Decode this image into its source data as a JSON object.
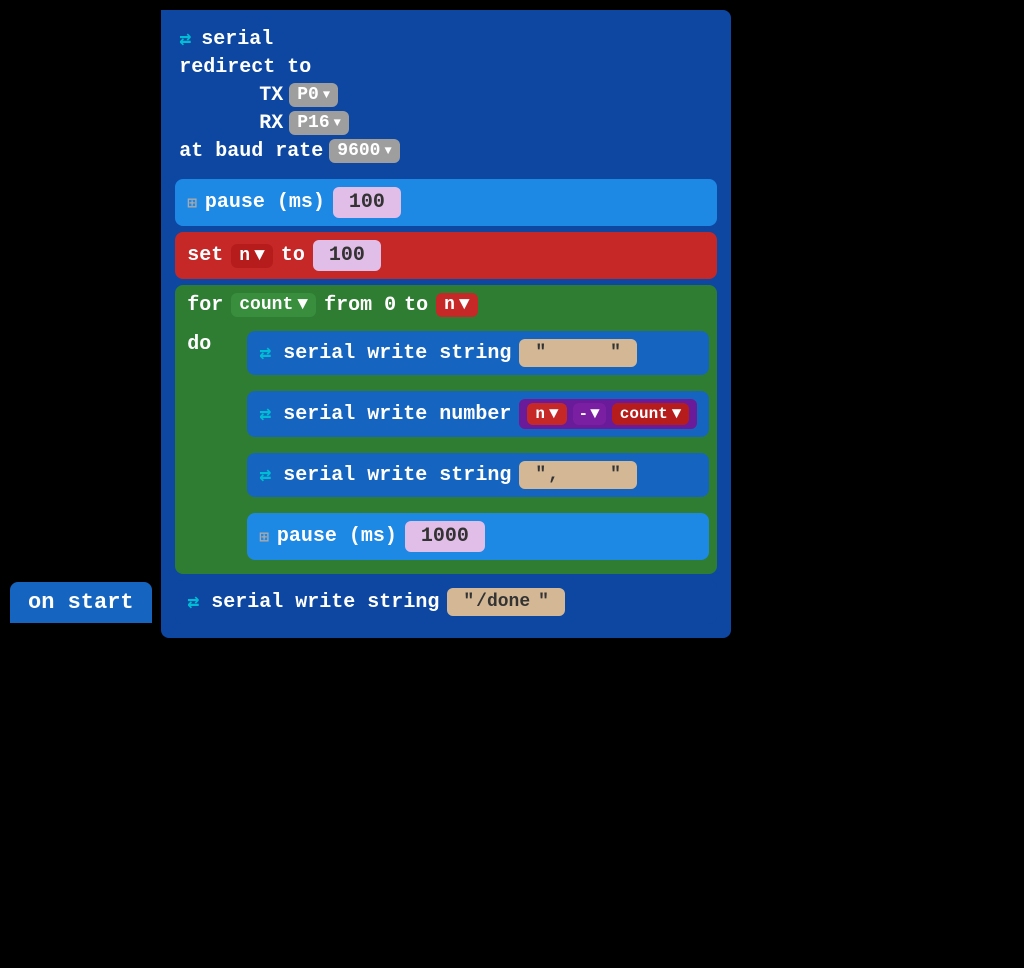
{
  "header": {
    "title": "on start"
  },
  "serial_redirect": {
    "line1": "serial",
    "line2": "redirect to",
    "tx_label": "TX",
    "tx_value": "P0",
    "rx_label": "RX",
    "rx_value": "P16",
    "baud_label": "at baud rate",
    "baud_value": "9600"
  },
  "pause1": {
    "label": "pause (ms)",
    "value": "100"
  },
  "set_block": {
    "label": "set",
    "var": "n",
    "to": "to",
    "value": "100"
  },
  "for_block": {
    "label": "for",
    "var": "count",
    "from": "from 0",
    "to": "to",
    "n_var": "n",
    "do_label": "do"
  },
  "serial_write_string1": {
    "label": "serial write string",
    "value": ""
  },
  "serial_write_number": {
    "label": "serial write number",
    "n_var": "n",
    "op": "-",
    "count_var": "count"
  },
  "serial_write_string2": {
    "label": "serial write string",
    "value": ","
  },
  "pause2": {
    "label": "pause (ms)",
    "value": "1000"
  },
  "serial_write_done": {
    "label": "serial write string",
    "value": "/done"
  },
  "icons": {
    "usb": "⇄",
    "grid": "⊞"
  }
}
